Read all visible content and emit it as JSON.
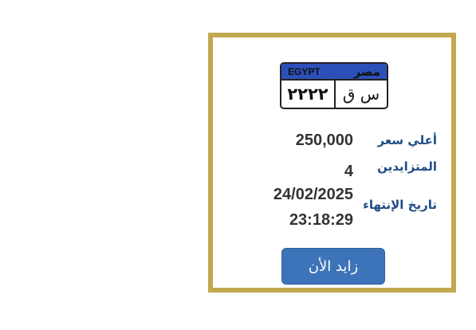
{
  "plate": {
    "country_en": "EGYPT",
    "country_ar": "مصر",
    "letters": "س ق",
    "numbers": "٢٢٢٢"
  },
  "auction": {
    "highest_price_label": "أعلي سعر",
    "highest_price_value": "250,000",
    "bidders_label": "المتزايدين",
    "bidders_value": "4",
    "end_date_label": "تاريخ الإنتهاء",
    "end_date_value": "24/02/2025",
    "end_time_value": "23:18:29"
  },
  "actions": {
    "bid_now_label": "زايد الأن"
  },
  "colors": {
    "border": "#c2a84f",
    "label": "#1f4d86",
    "button": "#3d73b8",
    "plate_header": "#2d4fb8"
  }
}
